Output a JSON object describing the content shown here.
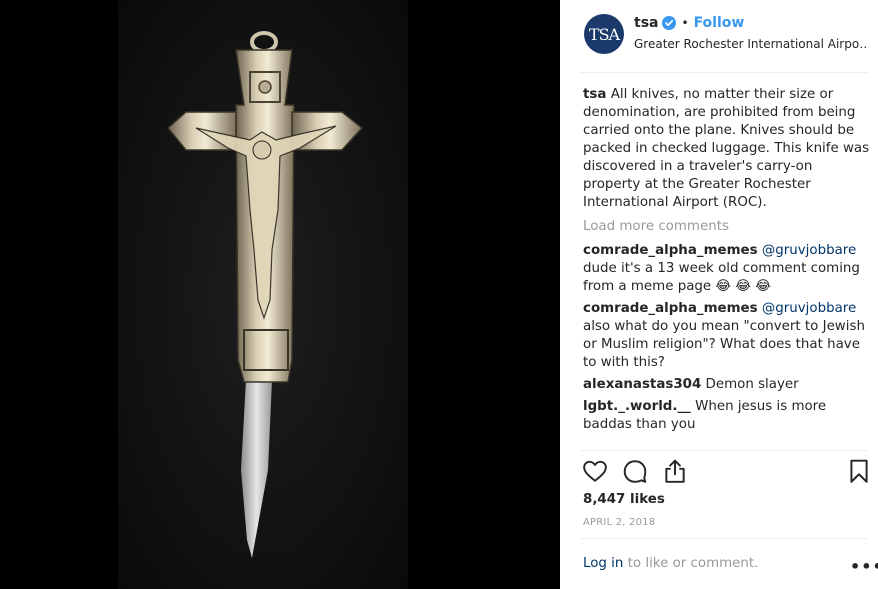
{
  "header": {
    "avatar_text": "TSA",
    "username": "tsa",
    "separator": "•",
    "follow_label": "Follow",
    "location": "Greater Rochester International Airpo…"
  },
  "caption": {
    "username": "tsa",
    "text": "All knives, no matter their size or denomination, are prohibited from being carried onto the plane. Knives should be packed in checked luggage. This knife was discovered in a traveler's carry-on property at the Greater Rochester International Airport (ROC)."
  },
  "load_more_label": "Load more comments",
  "comments": [
    {
      "username": "comrade_alpha_memes",
      "mention": "@gruvjobbare",
      "text": "dude it's a 13 week old comment coming from a meme page 😂 😂 😂"
    },
    {
      "username": "comrade_alpha_memes",
      "mention": "@gruvjobbare",
      "text": "also what do you mean \"convert to Jewish or Muslim religion\"? What does that have to with this?"
    },
    {
      "username": "alexanastas304",
      "mention": "",
      "text": "Demon slayer"
    },
    {
      "username": "lgbt._.world.__",
      "mention": "",
      "text": "When jesus is more baddas than you"
    }
  ],
  "actions": {
    "like_icon": "heart-icon",
    "comment_icon": "comment-icon",
    "share_icon": "share-icon",
    "save_icon": "bookmark-icon"
  },
  "likes": "8,447 likes",
  "date": "APRIL 2, 2018",
  "footer": {
    "login_label": "Log in",
    "login_suffix": "to like or comment.",
    "more_label": "•••"
  },
  "colors": {
    "link_blue": "#3897f0",
    "mention_blue": "#003569",
    "muted_text": "#999999",
    "avatar_bg": "#1b3a6b"
  }
}
